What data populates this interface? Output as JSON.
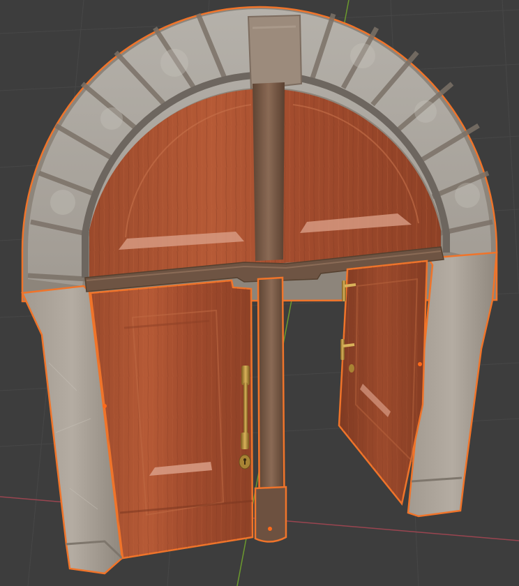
{
  "viewport": {
    "background": "#3d3d3d",
    "grid_color": "#474747",
    "x_axis_color": "#9a4550",
    "y_axis_color": "#6c9a2e",
    "selection_outline_color": "#f0742a",
    "origin_dot_color": "#ff6a1a"
  },
  "scene": {
    "objects": [
      {
        "name": "stone-arch",
        "selected": true,
        "material": "stone"
      },
      {
        "name": "arch-keystone",
        "selected": true,
        "material": "stone"
      },
      {
        "name": "arch-tympanum-wood-panel",
        "selected": true,
        "material": "wood"
      },
      {
        "name": "center-mullion-post",
        "selected": true,
        "material": "wood"
      },
      {
        "name": "left-door-leaf",
        "selected": true,
        "material": "wood",
        "state": "closed"
      },
      {
        "name": "right-door-leaf",
        "selected": true,
        "material": "wood",
        "state": "open"
      },
      {
        "name": "door-handle",
        "selected": true,
        "material": "brass"
      }
    ],
    "icons": [
      "keyhole-icon"
    ]
  }
}
